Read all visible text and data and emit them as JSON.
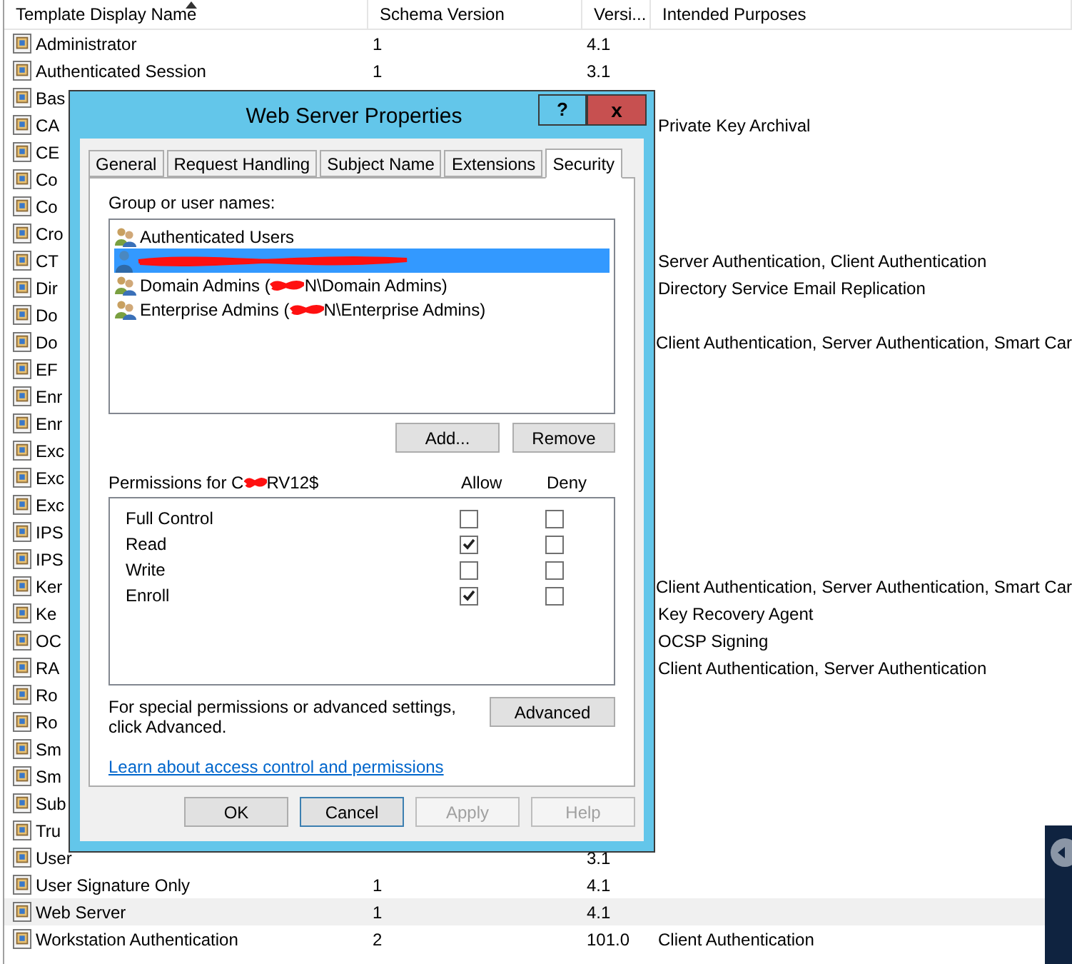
{
  "list": {
    "columns": [
      {
        "label": "Template Display Name",
        "sorted": true
      },
      {
        "label": "Schema Version",
        "sorted": false
      },
      {
        "label": "Versi...",
        "sorted": false
      },
      {
        "label": "Intended Purposes",
        "sorted": false
      }
    ],
    "rows": [
      {
        "name": "Administrator",
        "schema": "1",
        "version": "4.1",
        "selected": false
      },
      {
        "name": "Authenticated Session",
        "schema": "1",
        "version": "3.1",
        "selected": false
      },
      {
        "name": "Bas",
        "selected": false
      },
      {
        "name": "CA",
        "purposes": "Private Key Archival",
        "selected": false
      },
      {
        "name": "CE",
        "selected": false
      },
      {
        "name": "Co",
        "selected": false
      },
      {
        "name": "Co",
        "selected": false
      },
      {
        "name": "Cro",
        "selected": false
      },
      {
        "name": "CT",
        "purposes": "Server Authentication, Client Authentication",
        "selected": false
      },
      {
        "name": "Dir",
        "purposes": "Directory Service Email Replication",
        "selected": false
      },
      {
        "name": "Do",
        "selected": false
      },
      {
        "name": "Do",
        "purposes": "Client Authentication, Server Authentication, Smart Car",
        "selected": false
      },
      {
        "name": "EF",
        "selected": false
      },
      {
        "name": "Enr",
        "selected": false
      },
      {
        "name": "Enr",
        "selected": false
      },
      {
        "name": "Exc",
        "selected": false
      },
      {
        "name": "Exc",
        "selected": false
      },
      {
        "name": "Exc",
        "selected": false
      },
      {
        "name": "IPS",
        "selected": false
      },
      {
        "name": "IPS",
        "selected": false
      },
      {
        "name": "Ker",
        "purposes": "Client Authentication, Server Authentication, Smart Car",
        "selected": false
      },
      {
        "name": "Ke",
        "purposes": "Key Recovery Agent",
        "selected": false
      },
      {
        "name": "OC",
        "purposes": "OCSP Signing",
        "selected": false
      },
      {
        "name": "RA",
        "purposes": "Client Authentication, Server Authentication",
        "selected": false
      },
      {
        "name": "Ro",
        "selected": false
      },
      {
        "name": "Ro",
        "selected": false
      },
      {
        "name": "Sm",
        "selected": false
      },
      {
        "name": "Sm",
        "selected": false
      },
      {
        "name": "Sub",
        "selected": false
      },
      {
        "name": "Tru",
        "selected": false
      },
      {
        "name": "User",
        "version": "3.1",
        "selected": false
      },
      {
        "name": "User Signature Only",
        "schema": "1",
        "version": "4.1",
        "selected": false
      },
      {
        "name": "Web Server",
        "schema": "1",
        "version": "4.1",
        "selected": true
      },
      {
        "name": "Workstation Authentication",
        "schema": "2",
        "version": "101.0",
        "purposes": "Client Authentication",
        "selected": false
      }
    ]
  },
  "dialog": {
    "title": "Web Server Properties",
    "help": "?",
    "close": "x",
    "tabs": [
      {
        "label": "General",
        "selected": false
      },
      {
        "label": "Request Handling",
        "selected": false
      },
      {
        "label": "Subject Name",
        "selected": false
      },
      {
        "label": "Extensions",
        "selected": false
      },
      {
        "label": "Security",
        "selected": true
      }
    ],
    "group_label": "Group or user names:",
    "principals": [
      {
        "kind": "group",
        "label": "Authenticated Users",
        "selected": false
      },
      {
        "kind": "user",
        "redacted": true,
        "selected": true
      },
      {
        "kind": "group",
        "label": "Domain Admins (",
        "label_after": "N\\Domain Admins)",
        "redacted": true,
        "selected": false
      },
      {
        "kind": "group",
        "label": "Enterprise Admins (",
        "label_after": "N\\Enterprise Admins)",
        "redacted": true,
        "selected": false
      }
    ],
    "add_button": "Add...",
    "remove_button": "Remove",
    "permissions_label": "Permissions for C",
    "permissions_label_after": "RV12$",
    "allow_header": "Allow",
    "deny_header": "Deny",
    "permissions": [
      {
        "name": "Full Control",
        "allow": false,
        "deny": false
      },
      {
        "name": "Read",
        "allow": true,
        "deny": false
      },
      {
        "name": "Write",
        "allow": false,
        "deny": false
      },
      {
        "name": "Enroll",
        "allow": true,
        "deny": false
      }
    ],
    "advanced_text": "For special permissions or advanced settings, click Advanced.",
    "advanced_button": "Advanced",
    "link": "Learn about access control and permissions",
    "buttons": [
      {
        "label": "OK",
        "disabled": false,
        "focused": false
      },
      {
        "label": "Cancel",
        "disabled": false,
        "focused": true
      },
      {
        "label": "Apply",
        "disabled": true,
        "focused": false
      },
      {
        "label": "Help",
        "disabled": true,
        "focused": false
      }
    ]
  }
}
